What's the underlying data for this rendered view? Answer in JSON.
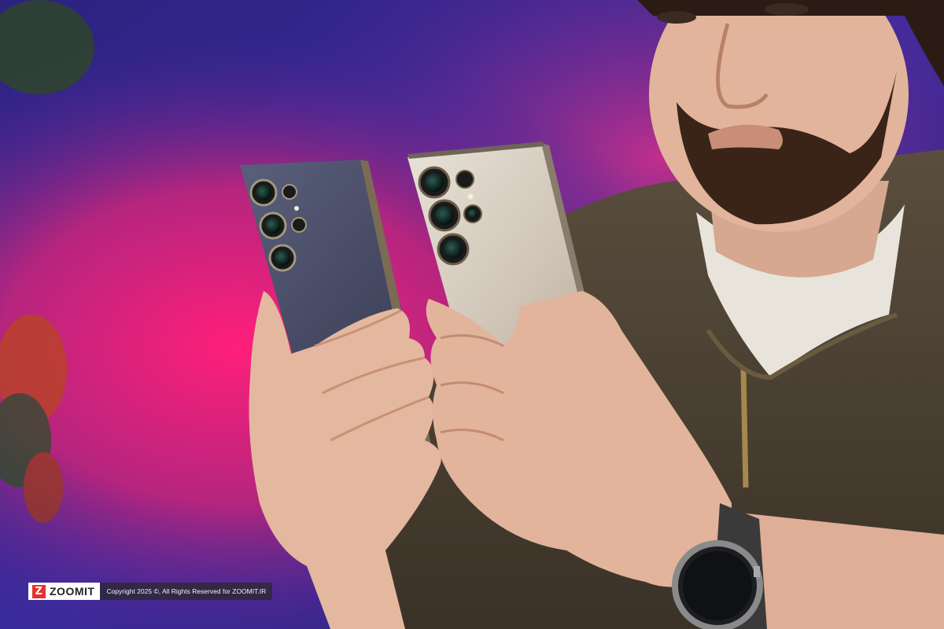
{
  "scene": {
    "subject": "man-holding-two-phones",
    "colors": {
      "background_purple": "#3a2a9a",
      "background_magenta": "#c8207c",
      "phone_left": "#4c5068",
      "phone_right": "#d8d0c4",
      "jacket": "#4a3f30",
      "skin": "#e4b79f"
    }
  },
  "watermark": {
    "logo_mark": "Z",
    "brand": "ZOOMIT",
    "copyright": "Copyright 2025 ©, All Rights Reserved for ZOOMIT.IR"
  }
}
